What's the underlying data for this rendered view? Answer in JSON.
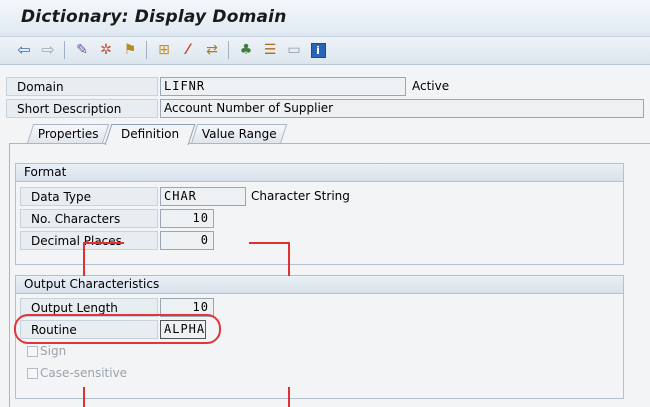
{
  "window": {
    "title": "Dictionary: Display Domain"
  },
  "toolbar": {
    "buttons": [
      {
        "name": "back-arrow-icon",
        "glyph": "⇦",
        "color": "#3a6fb0"
      },
      {
        "name": "forward-arrow-icon",
        "glyph": "⇨",
        "color": "#9aa9ba"
      },
      {
        "name": "display-change-icon",
        "glyph": "✎",
        "color": "#6a5a9a"
      },
      {
        "name": "activate-icon",
        "glyph": "✲",
        "color": "#c0573a"
      },
      {
        "name": "check-icon",
        "glyph": "⚑",
        "color": "#b98a1a"
      },
      {
        "name": "other-object-icon",
        "glyph": "⊞",
        "color": "#c98b1a"
      },
      {
        "name": "wand-icon",
        "glyph": "⁄",
        "color": "#c04020"
      },
      {
        "name": "where-used-icon",
        "glyph": "⇄",
        "color": "#b07a20"
      },
      {
        "name": "hierarchy-icon",
        "glyph": "♣",
        "color": "#3c7d3c"
      },
      {
        "name": "stack-icon",
        "glyph": "☰",
        "color": "#b06a1a"
      },
      {
        "name": "layout-icon",
        "glyph": "▭",
        "color": "#8b9bab"
      },
      {
        "name": "info-icon",
        "glyph": "i",
        "color": "#2a64b8"
      }
    ]
  },
  "header": {
    "domain_label": "Domain",
    "domain_value": "LIFNR",
    "status": "Active",
    "short_desc_label": "Short Description",
    "short_desc_value": "Account Number of Supplier"
  },
  "tabs": [
    {
      "label": "Properties",
      "active": false
    },
    {
      "label": "Definition",
      "active": true
    },
    {
      "label": "Value Range",
      "active": false
    }
  ],
  "format": {
    "heading": "Format",
    "data_type_label": "Data Type",
    "data_type_value": "CHAR",
    "data_type_desc": "Character String",
    "no_chars_label": "No. Characters",
    "no_chars_value": "10",
    "decimal_places_label": "Decimal Places",
    "decimal_places_value": "0"
  },
  "output": {
    "heading": "Output Characteristics",
    "output_length_label": "Output Length",
    "output_length_value": "10",
    "routine_label": "Routine",
    "routine_value": "ALPHA",
    "sign_label": "Sign",
    "sign_checked": false,
    "case_label": "Case-sensitive",
    "case_checked": false
  },
  "colors": {
    "annotation": "#e0353b",
    "accent": "#2a64b8"
  }
}
